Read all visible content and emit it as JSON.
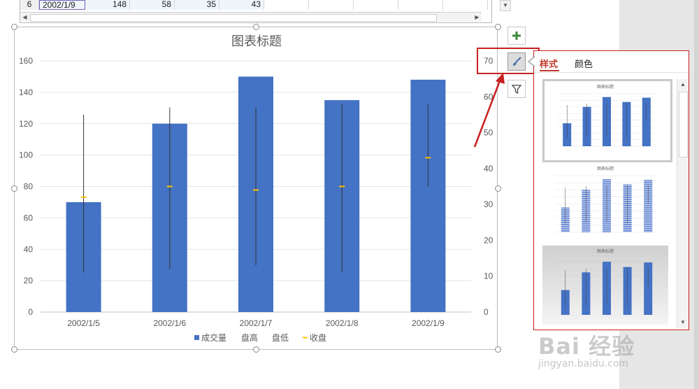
{
  "spreadsheet": {
    "row_number": "6",
    "date": "2002/1/9",
    "volume": "148",
    "high": "58",
    "low": "35",
    "close": "43"
  },
  "side_buttons": {
    "add": "add-chart-element",
    "style": "chart-styles",
    "filter": "chart-filters"
  },
  "style_panel": {
    "tabs": [
      {
        "label": "样式",
        "active": true
      },
      {
        "label": "颜色",
        "active": false
      }
    ],
    "thumb_titles": [
      "图表标题",
      "图表标题",
      "图表标题"
    ]
  },
  "watermark": {
    "main": "Bai 经验",
    "url": "jingyan.baidu.com"
  },
  "colors": {
    "bar": "#4472c4",
    "close_marker": "#ffc000",
    "highlight": "#c8201e",
    "panel_accent": "#c0392b"
  },
  "chart_data": {
    "type": "bar",
    "title": "图表标题",
    "categories": [
      "2002/1/5",
      "2002/1/6",
      "2002/1/7",
      "2002/1/8",
      "2002/1/9"
    ],
    "series": [
      {
        "name": "成交量",
        "axis": "left",
        "values": [
          70,
          120,
          150,
          135,
          148
        ]
      },
      {
        "name": "盘高",
        "axis": "right",
        "values": [
          55,
          57,
          57,
          58,
          58
        ]
      },
      {
        "name": "盘低",
        "axis": "right",
        "values": [
          11,
          12,
          13,
          11,
          35
        ]
      },
      {
        "name": "收盘",
        "axis": "right",
        "values": [
          32,
          35,
          34,
          35,
          43
        ]
      }
    ],
    "y_left": {
      "min": 0,
      "max": 160,
      "ticks": [
        0,
        20,
        40,
        60,
        80,
        100,
        120,
        140,
        160
      ]
    },
    "y_right": {
      "min": 0,
      "max": 70,
      "ticks": [
        0,
        10,
        20,
        30,
        40,
        50,
        60,
        70
      ]
    },
    "legend": [
      "成交量",
      "盘高",
      "盘低",
      "收盘"
    ],
    "legend_position": "bottom",
    "grid": true
  }
}
